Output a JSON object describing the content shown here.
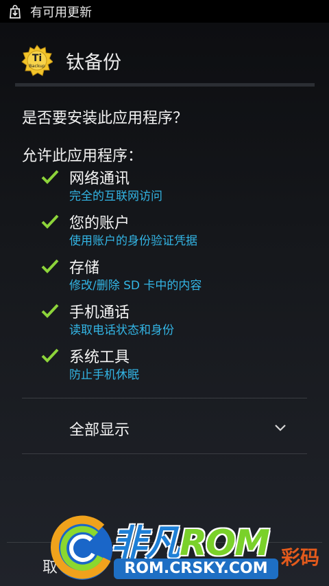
{
  "status_bar": {
    "notification_text": "有可用更新",
    "icon": "download-bag-icon"
  },
  "app": {
    "name": "钛备份",
    "icon": "titanium-backup-icon"
  },
  "question": "是否要安装此应用程序？",
  "permissions_heading": "允许此应用程序：",
  "permissions": [
    {
      "title": "网络通讯",
      "description": "完全的互联网访问"
    },
    {
      "title": "您的账户",
      "description": "使用账户的身份验证凭据"
    },
    {
      "title": "存储",
      "description": "修改/删除 SD 卡中的内容"
    },
    {
      "title": "手机通话",
      "description": "读取电话状态和身份"
    },
    {
      "title": "系统工具",
      "description": "防止手机休眠"
    }
  ],
  "show_all": {
    "label": "全部显示",
    "icon": "chevron-down-icon"
  },
  "actions": {
    "cancel_label": "取"
  },
  "watermark": {
    "brand_text_1": "非凡",
    "brand_text_2": "ROM",
    "url": "ROM.CRSKY.COM",
    "tag": "彩码"
  },
  "colors": {
    "accent_blue": "#33b5e5",
    "check_green": "#8dd43a",
    "background": "#15171b"
  }
}
